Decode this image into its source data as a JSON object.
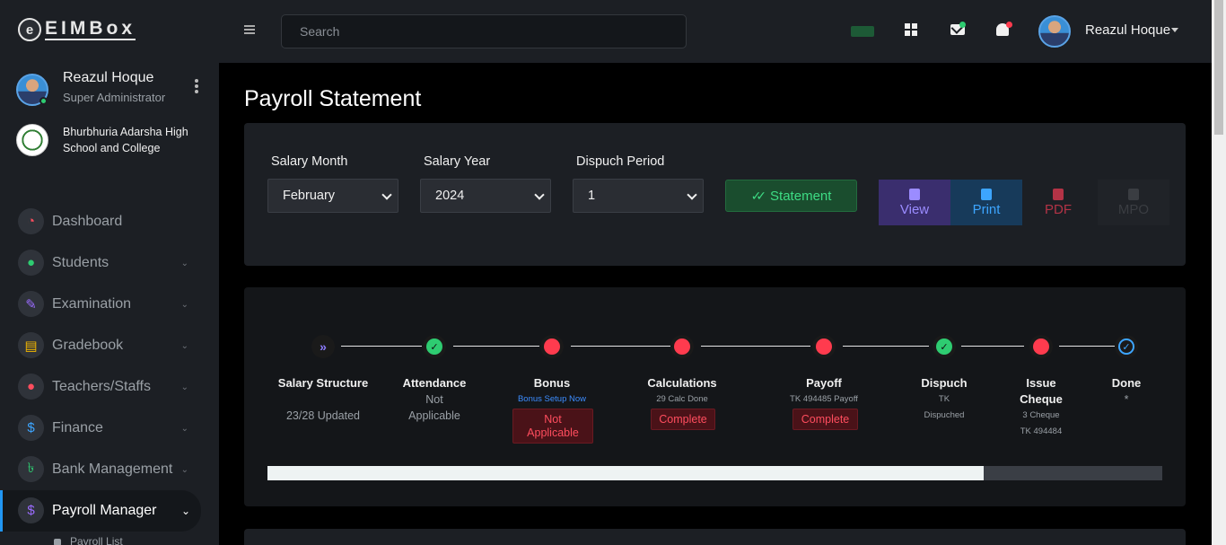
{
  "app": {
    "logo_letter": "e",
    "logo_text": "EIMBox"
  },
  "sidebar": {
    "user": {
      "name": "Reazul Hoque",
      "role": "Super Administrator"
    },
    "school": {
      "name": "Bhurbhuria Adarsha High School and College"
    },
    "items": [
      {
        "label": "Dashboard",
        "icon": "gauge-icon",
        "icon_color": "#ff4d5e",
        "glyph": "◔",
        "has_chevron": false
      },
      {
        "label": "Students",
        "icon": "users-icon",
        "icon_color": "#2ecc71",
        "glyph": "👥",
        "has_chevron": true
      },
      {
        "label": "Examination",
        "icon": "pen-icon",
        "icon_color": "#9b6cff",
        "glyph": "✎",
        "has_chevron": true
      },
      {
        "label": "Gradebook",
        "icon": "document-icon",
        "icon_color": "#f5b800",
        "glyph": "▤",
        "has_chevron": true
      },
      {
        "label": "Teachers/Staffs",
        "icon": "user-circle-icon",
        "icon_color": "#ff4d5e",
        "glyph": "●",
        "has_chevron": true
      },
      {
        "label": "Finance",
        "icon": "dollar-icon",
        "icon_color": "#3da5ff",
        "glyph": "$",
        "has_chevron": true
      },
      {
        "label": "Bank Management",
        "icon": "taka-icon",
        "icon_color": "#2ecc71",
        "glyph": "৳",
        "has_chevron": true
      },
      {
        "label": "Payroll Manager",
        "icon": "dollar-icon",
        "icon_color": "#9b6cff",
        "glyph": "$",
        "has_chevron": true,
        "active": true
      }
    ],
    "sub_item": "Payroll List"
  },
  "header": {
    "search_placeholder": "Search",
    "user_name": "Reazul Hoque"
  },
  "page": {
    "title": "Payroll Statement",
    "filters": {
      "salary_month": {
        "label": "Salary Month",
        "value": "February"
      },
      "salary_year": {
        "label": "Salary Year",
        "value": "2024"
      },
      "dispuch_period": {
        "label": "Dispuch Period",
        "value": "1"
      }
    },
    "statement_button": "Statement",
    "actions": {
      "view": "View",
      "print": "Print",
      "pdf": "PDF",
      "mpo": "MPO"
    }
  },
  "steps": {
    "progress": 0.8,
    "items": [
      {
        "title": "Salary Structure",
        "status": "purple",
        "sub": "23/28 Updated"
      },
      {
        "title": "Attendance",
        "status": "green",
        "sub": "Not Applicable"
      },
      {
        "title": "Bonus",
        "status": "red",
        "link": "Bonus Setup Now",
        "badge": "Not Applicable"
      },
      {
        "title": "Calculations",
        "status": "red",
        "small": "29 Calc Done",
        "badge": "Complete"
      },
      {
        "title": "Payoff",
        "status": "red",
        "small": "TK 494485 Payoff",
        "badge": "Complete"
      },
      {
        "title": "Dispuch",
        "status": "green",
        "small": "TK",
        "small2": "Dispuched"
      },
      {
        "title": "Issue Cheque",
        "status": "red",
        "small": "3 Cheque",
        "small2": "TK 494484"
      },
      {
        "title": "Done",
        "status": "blue",
        "sub": "*"
      }
    ]
  }
}
